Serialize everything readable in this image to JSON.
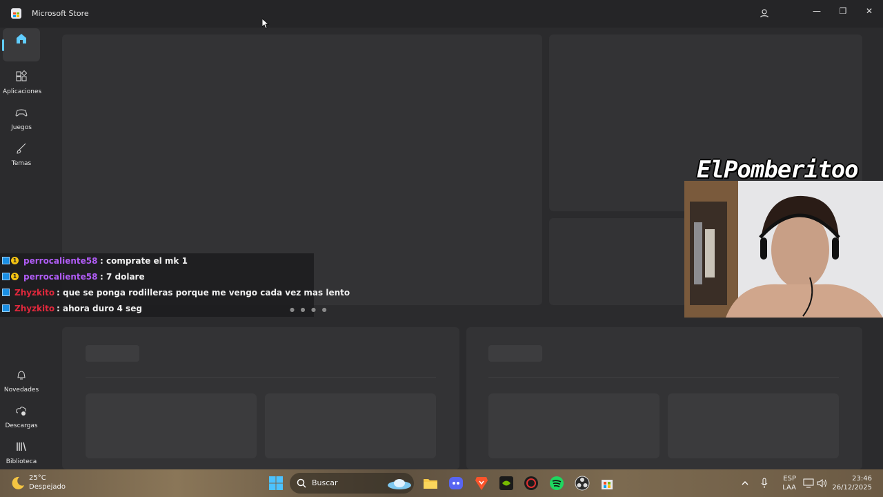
{
  "window": {
    "title": "Microsoft Store"
  },
  "sidebar": {
    "items": [
      {
        "name": "home",
        "label": ""
      },
      {
        "name": "apps",
        "label": "Aplicaciones"
      },
      {
        "name": "games",
        "label": "Juegos"
      },
      {
        "name": "themes",
        "label": "Temas"
      },
      {
        "name": "whatsnew",
        "label": "Novedades"
      },
      {
        "name": "downloads",
        "label": "Descargas"
      },
      {
        "name": "library",
        "label": "Biblioteca"
      }
    ]
  },
  "overlay": {
    "streamer_name": "ElPomberitoo",
    "chat": [
      {
        "user": "perrocaliente58",
        "user_color": "#b05cf6",
        "text": ": comprate el mk 1",
        "badges": [
          "prime",
          "sub"
        ]
      },
      {
        "user": "perrocaliente58",
        "user_color": "#b05cf6",
        "text": ": 7 dolare",
        "badges": [
          "prime",
          "sub"
        ]
      },
      {
        "user": "Zhyzkito",
        "user_color": "#e0283c",
        "text": ": que se ponga rodilleras porque me vengo cada vez mas lento",
        "badges": [
          "prime"
        ]
      },
      {
        "user": "Zhyzkito",
        "user_color": "#e0283c",
        "text": ": ahora duro 4 seg",
        "badges": [
          "prime"
        ]
      }
    ]
  },
  "taskbar": {
    "weather": {
      "temp": "25°C",
      "desc": "Despejado"
    },
    "search_placeholder": "Buscar",
    "language": {
      "line1": "ESP",
      "line2": "LAA"
    },
    "clock": {
      "time": "23:46",
      "date": "26/12/2025"
    }
  },
  "colors": {
    "accent": "#60cdff"
  }
}
